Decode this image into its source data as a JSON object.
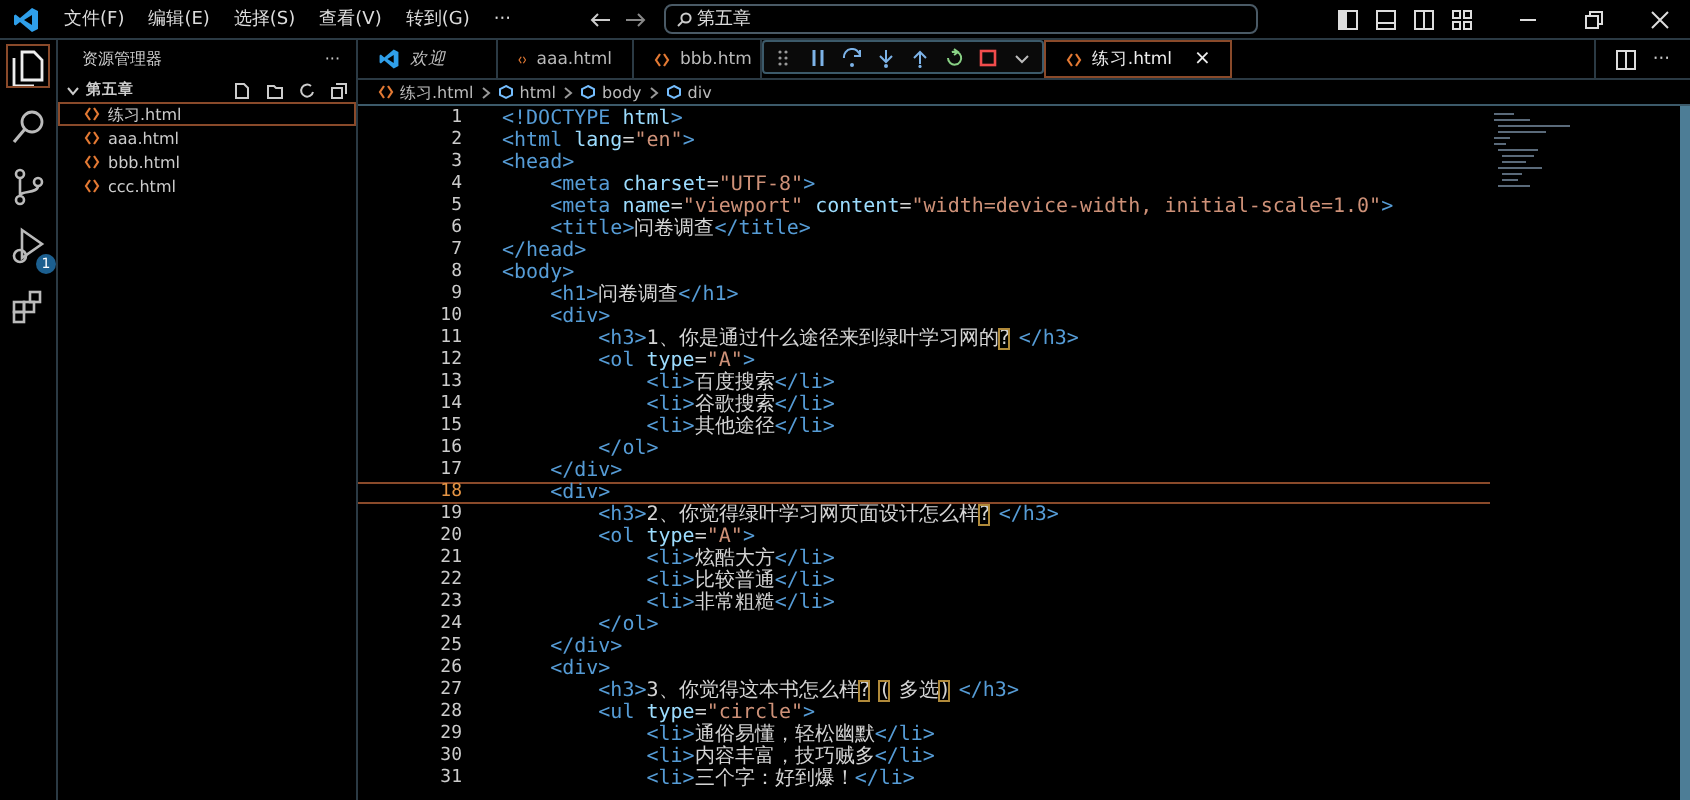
{
  "menu": [
    "文件(F)",
    "编辑(E)",
    "选择(S)",
    "查看(V)",
    "转到(G)",
    "···"
  ],
  "search": {
    "value": "第五章"
  },
  "activity": [
    {
      "kind": "files",
      "selected": true
    },
    {
      "kind": "search",
      "selected": false
    },
    {
      "kind": "git",
      "selected": false
    },
    {
      "kind": "debug",
      "selected": false,
      "badge": "1"
    },
    {
      "kind": "extensions",
      "selected": false
    }
  ],
  "sidebar": {
    "title": "资源管理器",
    "more": "···",
    "folder": {
      "name": "第五章",
      "expanded": true,
      "files": [
        {
          "name": "练习.html",
          "selected": true
        },
        {
          "name": "aaa.html",
          "selected": false
        },
        {
          "name": "bbb.html",
          "selected": false
        },
        {
          "name": "ccc.html",
          "selected": false
        }
      ]
    }
  },
  "tabs": [
    {
      "label": "欢迎",
      "kind": "welcome",
      "selected": false
    },
    {
      "label": "aaa.html",
      "kind": "html",
      "selected": false
    },
    {
      "label": "bbb.htm",
      "kind": "html",
      "selected": false
    },
    {
      "label": "练习.html",
      "kind": "html",
      "selected": true,
      "close": "×"
    }
  ],
  "tab_more": "···",
  "breadcrumb": [
    "练习.html",
    "html",
    "body",
    "div"
  ],
  "editor": {
    "lines": [
      {
        "number": "1",
        "current": false,
        "tokens": [
          {
            "kind": "tag",
            "text": "<!DOCTYPE "
          },
          {
            "kind": "attr",
            "text": "html"
          },
          {
            "kind": "tag",
            "text": ">"
          }
        ]
      },
      {
        "number": "2",
        "current": false,
        "tokens": [
          {
            "kind": "tag",
            "text": "<html "
          },
          {
            "kind": "attr",
            "text": "lang"
          },
          {
            "kind": "plain",
            "text": "="
          },
          {
            "kind": "string",
            "text": "\"en\""
          },
          {
            "kind": "tag",
            "text": ">"
          }
        ]
      },
      {
        "number": "3",
        "current": false,
        "tokens": [
          {
            "kind": "tag",
            "text": "<head>"
          }
        ]
      },
      {
        "number": "4",
        "current": false,
        "tokens": [
          {
            "kind": "tag",
            "text": "    <meta "
          },
          {
            "kind": "attr",
            "text": "charset"
          },
          {
            "kind": "plain",
            "text": "="
          },
          {
            "kind": "string",
            "text": "\"UTF-8\""
          },
          {
            "kind": "tag",
            "text": ">"
          }
        ]
      },
      {
        "number": "5",
        "current": false,
        "tokens": [
          {
            "kind": "tag",
            "text": "    <meta "
          },
          {
            "kind": "attr",
            "text": "name"
          },
          {
            "kind": "plain",
            "text": "="
          },
          {
            "kind": "string",
            "text": "\"viewport\" "
          },
          {
            "kind": "attr",
            "text": "content"
          },
          {
            "kind": "plain",
            "text": "="
          },
          {
            "kind": "string",
            "text": "\"width=device-width, initial-scale=1.0\""
          },
          {
            "kind": "tag",
            "text": ">"
          }
        ]
      },
      {
        "number": "6",
        "current": false,
        "tokens": [
          {
            "kind": "tag",
            "text": "    <title>"
          },
          {
            "kind": "plain",
            "text": "问卷调查"
          },
          {
            "kind": "tag",
            "text": "</title>"
          }
        ]
      },
      {
        "number": "7",
        "current": false,
        "tokens": [
          {
            "kind": "tag",
            "text": "</head>"
          }
        ]
      },
      {
        "number": "8",
        "current": false,
        "tokens": [
          {
            "kind": "tag",
            "text": "<body>"
          }
        ]
      },
      {
        "number": "9",
        "current": false,
        "tokens": [
          {
            "kind": "tag",
            "text": "    <h1>"
          },
          {
            "kind": "plain",
            "text": "问卷调查"
          },
          {
            "kind": "tag",
            "text": "</h1>"
          }
        ]
      },
      {
        "number": "10",
        "current": false,
        "tokens": [
          {
            "kind": "tag",
            "text": "    <div>"
          }
        ]
      },
      {
        "number": "11",
        "current": false,
        "tokens": [
          {
            "kind": "tag",
            "text": "        <h3>"
          },
          {
            "kind": "plain",
            "text": "1、你是通过什么途径来到绿叶学习网的"
          },
          {
            "kind": "match",
            "text": "?"
          },
          {
            "kind": "tag",
            "text": "</h3>"
          }
        ]
      },
      {
        "number": "12",
        "current": false,
        "tokens": [
          {
            "kind": "tag",
            "text": "        <ol "
          },
          {
            "kind": "attr",
            "text": "type"
          },
          {
            "kind": "plain",
            "text": "="
          },
          {
            "kind": "string",
            "text": "\"A\""
          },
          {
            "kind": "tag",
            "text": ">"
          }
        ]
      },
      {
        "number": "13",
        "current": false,
        "tokens": [
          {
            "kind": "tag",
            "text": "            <li>"
          },
          {
            "kind": "plain",
            "text": "百度搜索"
          },
          {
            "kind": "tag",
            "text": "</li>"
          }
        ]
      },
      {
        "number": "14",
        "current": false,
        "tokens": [
          {
            "kind": "tag",
            "text": "            <li>"
          },
          {
            "kind": "plain",
            "text": "谷歌搜索"
          },
          {
            "kind": "tag",
            "text": "</li>"
          }
        ]
      },
      {
        "number": "15",
        "current": false,
        "tokens": [
          {
            "kind": "tag",
            "text": "            <li>"
          },
          {
            "kind": "plain",
            "text": "其他途径"
          },
          {
            "kind": "tag",
            "text": "</li>"
          }
        ]
      },
      {
        "number": "16",
        "current": false,
        "tokens": [
          {
            "kind": "tag",
            "text": "        </ol>"
          }
        ]
      },
      {
        "number": "17",
        "current": false,
        "tokens": [
          {
            "kind": "tag",
            "text": "    </div>"
          }
        ]
      },
      {
        "number": "18",
        "current": true,
        "tokens": [
          {
            "kind": "tag",
            "text": "    <div>"
          }
        ]
      },
      {
        "number": "19",
        "current": false,
        "tokens": [
          {
            "kind": "tag",
            "text": "        <h3>"
          },
          {
            "kind": "plain",
            "text": "2、你觉得绿叶学习网页面设计怎么样"
          },
          {
            "kind": "match",
            "text": "?"
          },
          {
            "kind": "tag",
            "text": "</h3>"
          }
        ]
      },
      {
        "number": "20",
        "current": false,
        "tokens": [
          {
            "kind": "tag",
            "text": "        <ol "
          },
          {
            "kind": "attr",
            "text": "type"
          },
          {
            "kind": "plain",
            "text": "="
          },
          {
            "kind": "string",
            "text": "\"A\""
          },
          {
            "kind": "tag",
            "text": ">"
          }
        ]
      },
      {
        "number": "21",
        "current": false,
        "tokens": [
          {
            "kind": "tag",
            "text": "            <li>"
          },
          {
            "kind": "plain",
            "text": "炫酷大方"
          },
          {
            "kind": "tag",
            "text": "</li>"
          }
        ]
      },
      {
        "number": "22",
        "current": false,
        "tokens": [
          {
            "kind": "tag",
            "text": "            <li>"
          },
          {
            "kind": "plain",
            "text": "比较普通"
          },
          {
            "kind": "tag",
            "text": "</li>"
          }
        ]
      },
      {
        "number": "23",
        "current": false,
        "tokens": [
          {
            "kind": "tag",
            "text": "            <li>"
          },
          {
            "kind": "plain",
            "text": "非常粗糙"
          },
          {
            "kind": "tag",
            "text": "</li>"
          }
        ]
      },
      {
        "number": "24",
        "current": false,
        "tokens": [
          {
            "kind": "tag",
            "text": "        </ol>"
          }
        ]
      },
      {
        "number": "25",
        "current": false,
        "tokens": [
          {
            "kind": "tag",
            "text": "    </div>"
          }
        ]
      },
      {
        "number": "26",
        "current": false,
        "tokens": [
          {
            "kind": "tag",
            "text": "    <div>"
          }
        ]
      },
      {
        "number": "27",
        "current": false,
        "tokens": [
          {
            "kind": "tag",
            "text": "        <h3>"
          },
          {
            "kind": "plain",
            "text": "3、你觉得这本书怎么样"
          },
          {
            "kind": "match",
            "text": "?"
          },
          {
            "kind": "match",
            "text": "("
          },
          {
            "kind": "plain",
            "text": "多选"
          },
          {
            "kind": "match",
            "text": ")"
          },
          {
            "kind": "tag",
            "text": "</h3>"
          }
        ]
      },
      {
        "number": "28",
        "current": false,
        "tokens": [
          {
            "kind": "tag",
            "text": "        <ul "
          },
          {
            "kind": "attr",
            "text": "type"
          },
          {
            "kind": "plain",
            "text": "="
          },
          {
            "kind": "string",
            "text": "\"circle\""
          },
          {
            "kind": "tag",
            "text": ">"
          }
        ]
      },
      {
        "number": "29",
        "current": false,
        "tokens": [
          {
            "kind": "tag",
            "text": "            <li>"
          },
          {
            "kind": "plain",
            "text": "通俗易懂，轻松幽默"
          },
          {
            "kind": "tag",
            "text": "</li>"
          }
        ]
      },
      {
        "number": "30",
        "current": false,
        "tokens": [
          {
            "kind": "tag",
            "text": "            <li>"
          },
          {
            "kind": "plain",
            "text": "内容丰富，技巧贼多"
          },
          {
            "kind": "tag",
            "text": "</li>"
          }
        ]
      },
      {
        "number": "31",
        "current": false,
        "tokens": [
          {
            "kind": "tag",
            "text": "            <li>"
          },
          {
            "kind": "plain",
            "text": "三个字：好到爆！"
          },
          {
            "kind": "tag",
            "text": "</li>"
          }
        ]
      }
    ]
  }
}
